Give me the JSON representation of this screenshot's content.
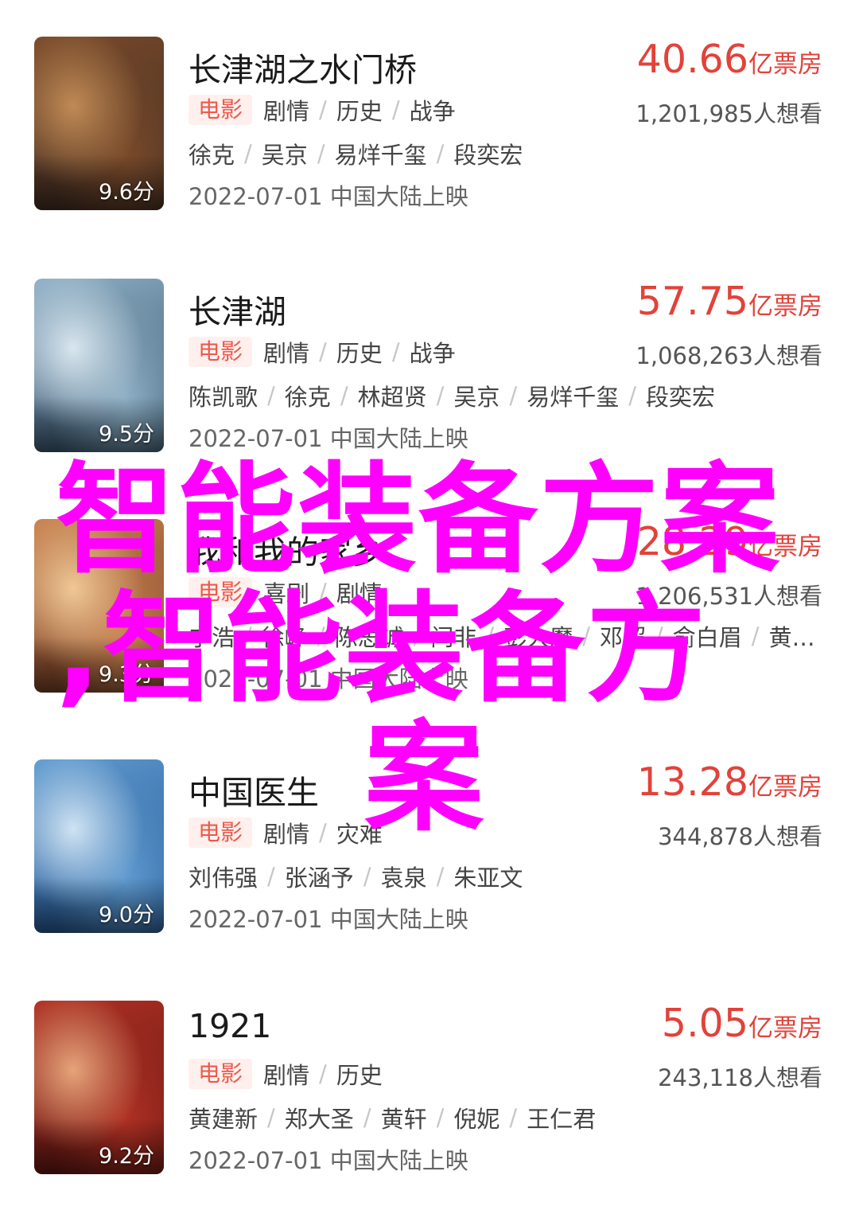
{
  "movies": [
    {
      "title": "长津湖之水门桥",
      "category": "电影",
      "genres": [
        "剧情",
        "历史",
        "战争"
      ],
      "cast": [
        "徐克",
        "吴京",
        "易烊千玺",
        "段奕宏"
      ],
      "release": "2022-07-01 中国大陆上映",
      "box_office": "40.66",
      "box_unit": "亿票房",
      "want": "1,201,985人想看",
      "score": "9.6分",
      "poster_colors": [
        "#3a2a22",
        "#7a4a2a",
        "#c08a55"
      ]
    },
    {
      "title": "长津湖",
      "category": "电影",
      "genres": [
        "剧情",
        "历史",
        "战争"
      ],
      "cast": [
        "陈凯歌",
        "徐克",
        "林超贤",
        "吴京",
        "易烊千玺",
        "段奕宏"
      ],
      "release": "2022-07-01 中国大陆上映",
      "box_office": "57.75",
      "box_unit": "亿票房",
      "want": "1,068,263人想看",
      "score": "9.5分",
      "poster_colors": [
        "#2e4b62",
        "#8fb0c6",
        "#d8e6ef"
      ]
    },
    {
      "title": "我和我的家乡",
      "category": "电影",
      "genres": [
        "喜剧",
        "剧情"
      ],
      "cast": [
        "宁浩",
        "徐峥",
        "陈思诚",
        "闫非",
        "彭大魔",
        "邓超",
        "俞白眉",
        "黄…"
      ],
      "release": "2022-07-01 中国大陆上映",
      "box_office": "28.29",
      "box_unit": "亿票房",
      "want": "1,206,531人想看",
      "score": "9.3分",
      "poster_colors": [
        "#6a3420",
        "#c9824f",
        "#f0c896"
      ]
    },
    {
      "title": "中国医生",
      "category": "电影",
      "genres": [
        "剧情",
        "灾难"
      ],
      "cast": [
        "刘伟强",
        "张涵予",
        "袁泉",
        "朱亚文"
      ],
      "release": "2022-07-01 中国大陆上映",
      "box_office": "13.28",
      "box_unit": "亿票房",
      "want": "344,878人想看",
      "score": "9.0分",
      "poster_colors": [
        "#1e4f8c",
        "#5f9bd0",
        "#cfe3f3"
      ]
    },
    {
      "title": "1921",
      "category": "电影",
      "genres": [
        "剧情",
        "历史"
      ],
      "cast": [
        "黄建新",
        "郑大圣",
        "黄轩",
        "倪妮",
        "王仁君"
      ],
      "release": "2022-07-01 中国大陆上映",
      "box_office": "5.05",
      "box_unit": "亿票房",
      "want": "243,118人想看",
      "score": "9.2分",
      "poster_colors": [
        "#5a1410",
        "#b03024",
        "#e6a47a"
      ]
    }
  ],
  "overlay": {
    "line1": "智能装备方案",
    "line2": ",智能装备方",
    "line3": "案"
  }
}
